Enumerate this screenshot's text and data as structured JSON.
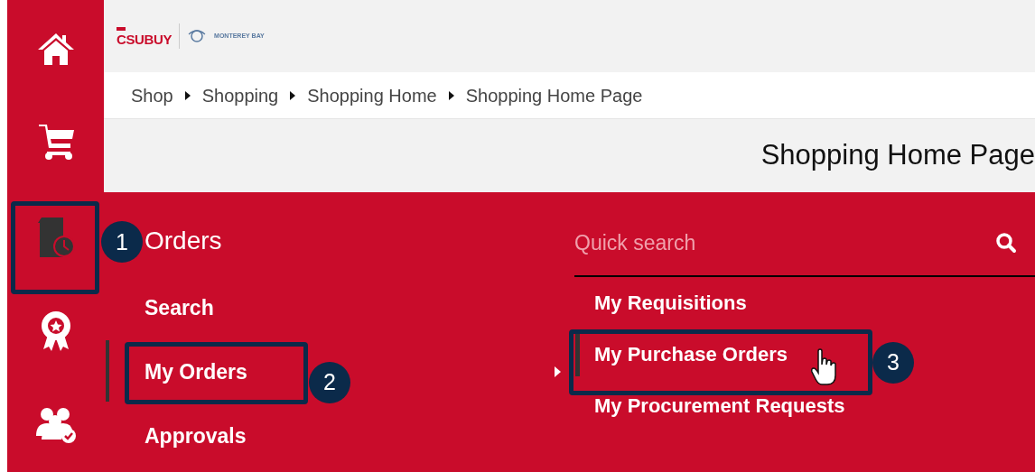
{
  "logo": {
    "brand": "CSUBUY",
    "campus": "MONTEREY BAY"
  },
  "breadcrumb": [
    "Shop",
    "Shopping",
    "Shopping Home",
    "Shopping Home Page"
  ],
  "page_title": "Shopping Home Page",
  "nav_icons": [
    {
      "kind": "home",
      "selected": false
    },
    {
      "kind": "cart",
      "selected": false
    },
    {
      "kind": "orders",
      "selected": true,
      "callout": "1"
    },
    {
      "kind": "award",
      "selected": false
    },
    {
      "kind": "people",
      "selected": false
    }
  ],
  "menu": {
    "heading": "Orders",
    "items": [
      {
        "label": "Search",
        "selected": false
      },
      {
        "label": "My Orders",
        "selected": true,
        "callout": "2"
      },
      {
        "label": "Approvals",
        "selected": false
      }
    ]
  },
  "quick_search": {
    "placeholder": "Quick search"
  },
  "submenu": [
    {
      "label": "My Requisitions",
      "selected": false
    },
    {
      "label": "My Purchase Orders",
      "selected": true,
      "callout": "3"
    },
    {
      "label": "My Procurement Requests",
      "selected": false
    }
  ]
}
